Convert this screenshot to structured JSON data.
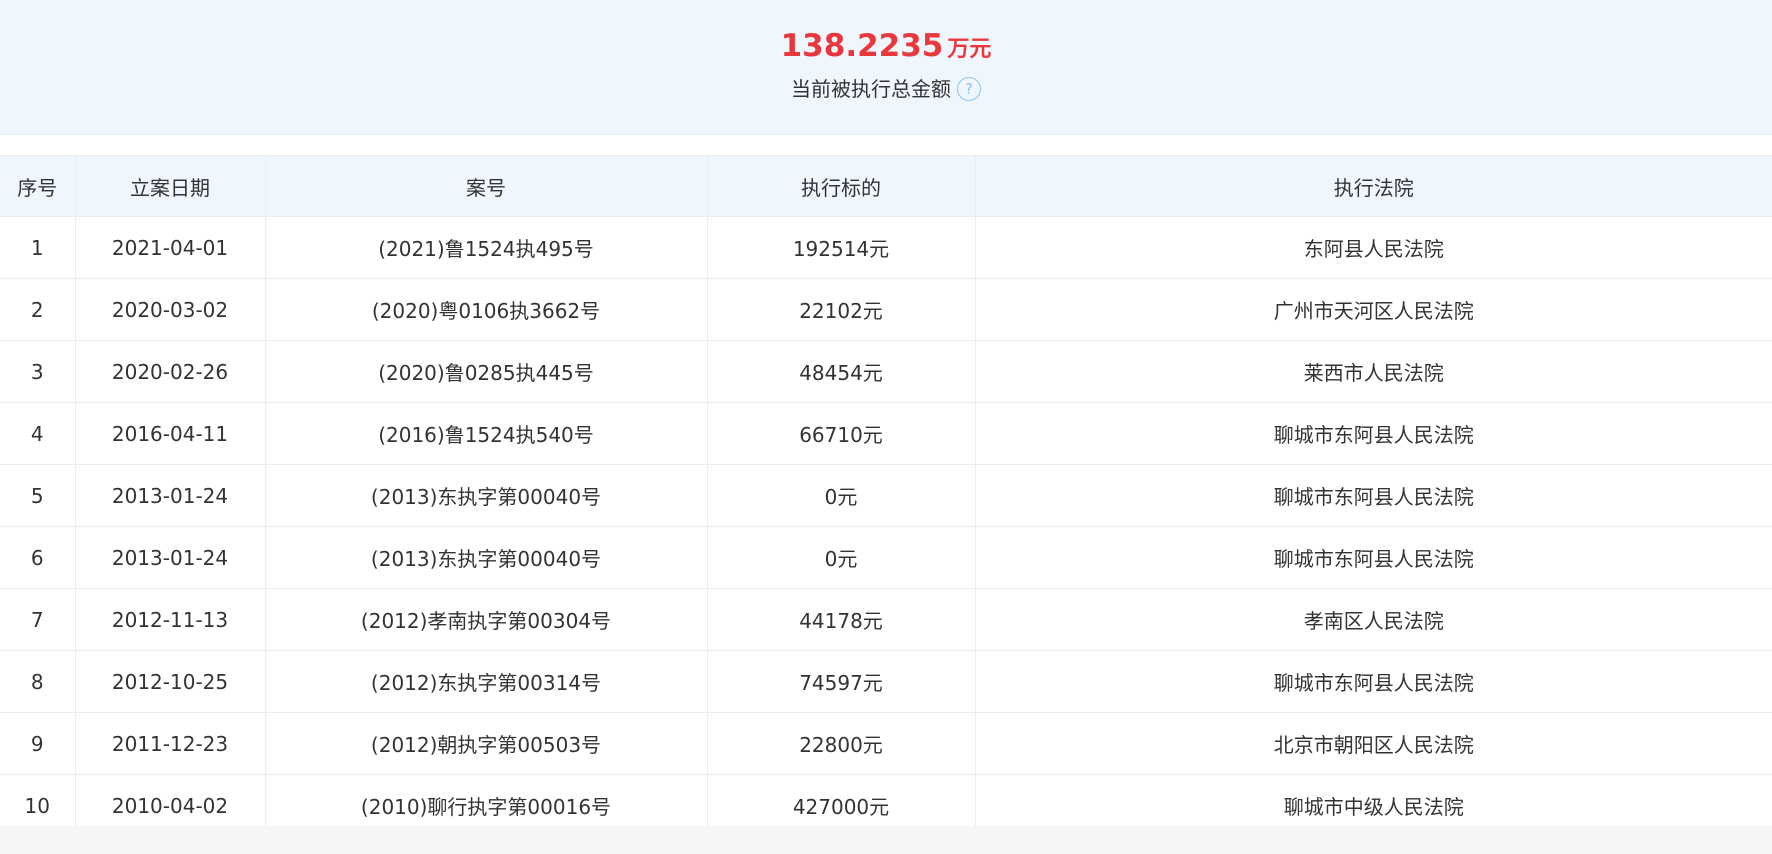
{
  "summary": {
    "amount": "138.2235",
    "unit": "万元",
    "label": "当前被执行总金额",
    "help_icon": "?"
  },
  "table": {
    "headers": [
      "序号",
      "立案日期",
      "案号",
      "执行标的",
      "执行法院"
    ],
    "rows": [
      [
        "1",
        "2021-04-01",
        "(2021)鲁1524执495号",
        "192514元",
        "东阿县人民法院"
      ],
      [
        "2",
        "2020-03-02",
        "(2020)粤0106执3662号",
        "22102元",
        "广州市天河区人民法院"
      ],
      [
        "3",
        "2020-02-26",
        "(2020)鲁0285执445号",
        "48454元",
        "莱西市人民法院"
      ],
      [
        "4",
        "2016-04-11",
        "(2016)鲁1524执540号",
        "66710元",
        "聊城市东阿县人民法院"
      ],
      [
        "5",
        "2013-01-24",
        "(2013)东执字第00040号",
        "0元",
        "聊城市东阿县人民法院"
      ],
      [
        "6",
        "2013-01-24",
        "(2013)东执字第00040号",
        "0元",
        "聊城市东阿县人民法院"
      ],
      [
        "7",
        "2012-11-13",
        "(2012)孝南执字第00304号",
        "44178元",
        "孝南区人民法院"
      ],
      [
        "8",
        "2012-10-25",
        "(2012)东执字第00314号",
        "74597元",
        "聊城市东阿县人民法院"
      ],
      [
        "9",
        "2011-12-23",
        "(2012)朝执字第00503号",
        "22800元",
        "北京市朝阳区人民法院"
      ],
      [
        "10",
        "2010-04-02",
        "(2010)聊行执字第00016号",
        "427000元",
        "聊城市中级人民法院"
      ]
    ]
  },
  "colors": {
    "accent_red": "#e8383d",
    "header_bg": "#eff6fd",
    "help_icon": "#8fc3ee"
  }
}
